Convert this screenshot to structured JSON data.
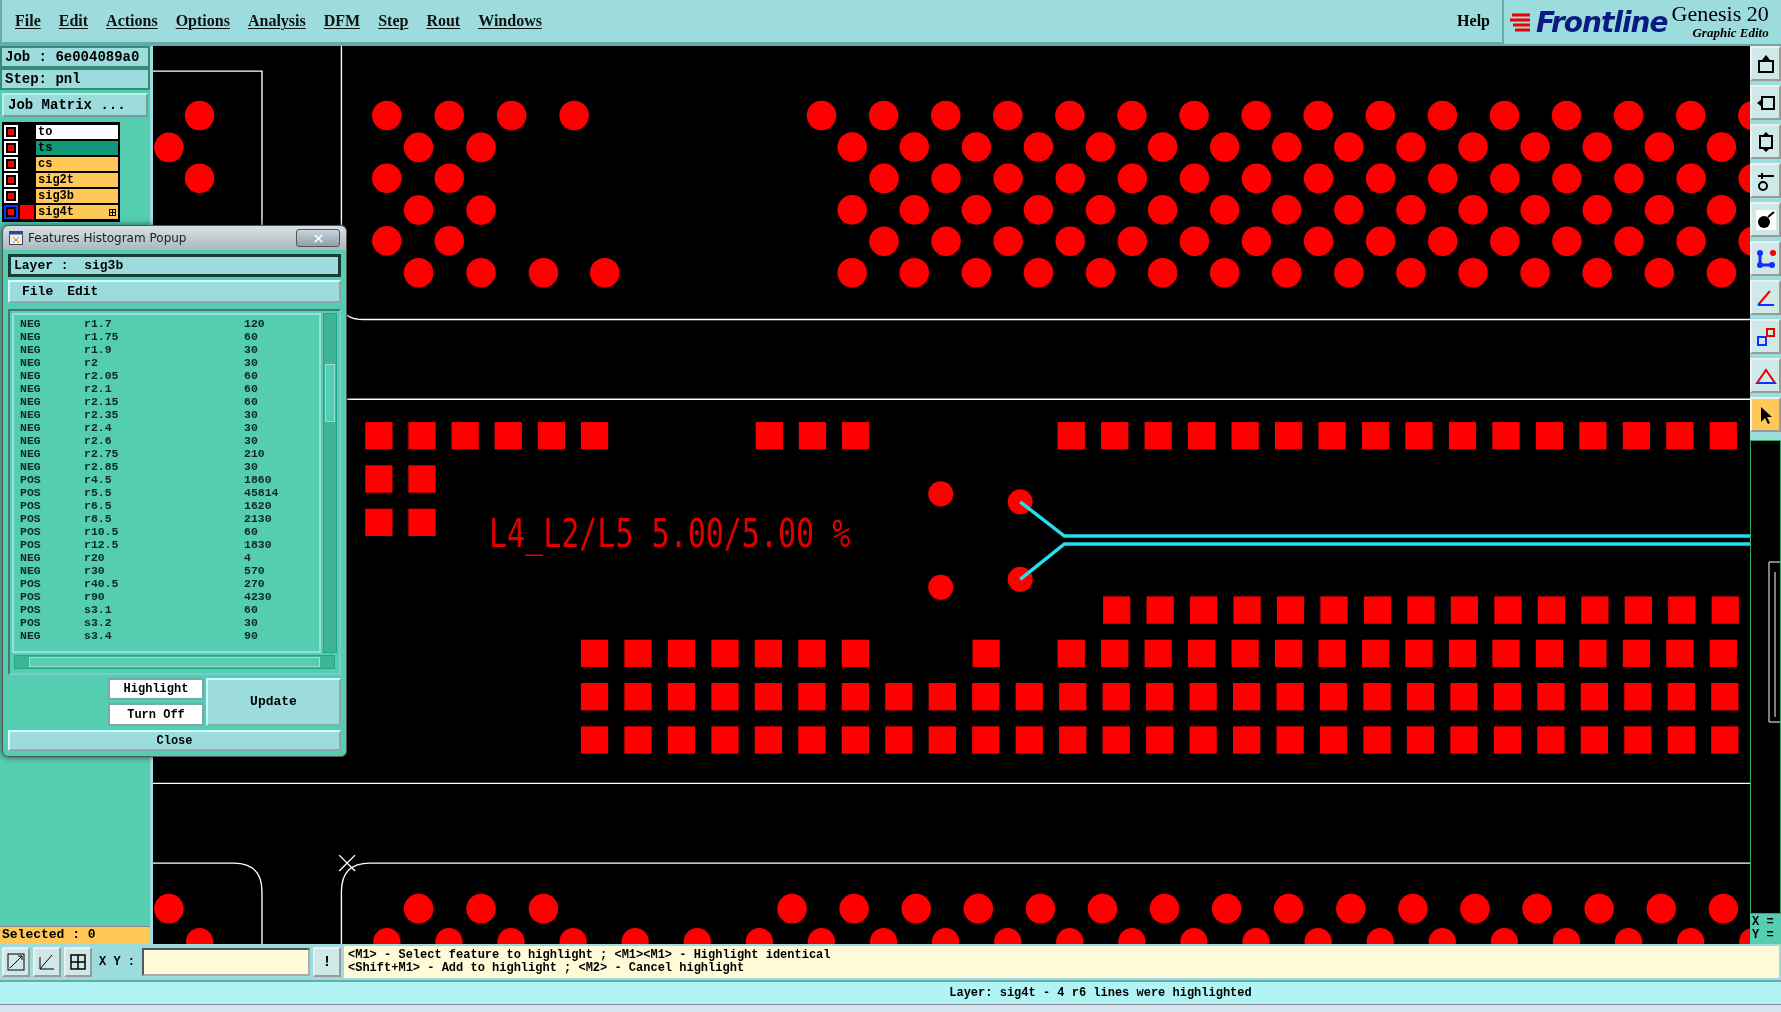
{
  "menu": [
    {
      "label": "File"
    },
    {
      "label": "Edit"
    },
    {
      "label": "Actions"
    },
    {
      "label": "Options"
    },
    {
      "label": "Analysis"
    },
    {
      "label": "DFM"
    },
    {
      "label": "Step"
    },
    {
      "label": "Rout"
    },
    {
      "label": "Windows"
    }
  ],
  "help": "Help",
  "logo": {
    "brand": "Frontline",
    "product": "Genesis 20",
    "subtitle": "Graphic Edito"
  },
  "job": "Job : 6e004089a0",
  "step": "Step: pnl",
  "job_matrix_button": "Job Matrix ...",
  "layers": [
    {
      "name": "to",
      "color": "#ffffff",
      "displayed": true,
      "selected": false
    },
    {
      "name": "ts",
      "color": "#119977",
      "displayed": true,
      "selected": false
    },
    {
      "name": "cs",
      "color": "#ffc857",
      "displayed": true,
      "selected": false
    },
    {
      "name": "sig2t",
      "color": "#ffc857",
      "displayed": true,
      "selected": false
    },
    {
      "name": "sig3b",
      "color": "#ffc857",
      "displayed": true,
      "selected": false
    },
    {
      "name": "sig4t",
      "color": "#ffc857",
      "displayed": true,
      "selected": true
    }
  ],
  "selected_count": "Selected : 0",
  "canvas": {
    "annotation": "L4_L2/L5 5.00/5.00 %"
  },
  "popup": {
    "title": "Features Histogram Popup",
    "layer": "Layer :  sig3b",
    "menu": [
      "File",
      "Edit"
    ],
    "rows": [
      {
        "polarity": "NEG",
        "symbol": "r1.7",
        "count": "120"
      },
      {
        "polarity": "NEG",
        "symbol": "r1.75",
        "count": "60"
      },
      {
        "polarity": "NEG",
        "symbol": "r1.9",
        "count": "30"
      },
      {
        "polarity": "NEG",
        "symbol": "r2",
        "count": "30"
      },
      {
        "polarity": "NEG",
        "symbol": "r2.05",
        "count": "60"
      },
      {
        "polarity": "NEG",
        "symbol": "r2.1",
        "count": "60"
      },
      {
        "polarity": "NEG",
        "symbol": "r2.15",
        "count": "60"
      },
      {
        "polarity": "NEG",
        "symbol": "r2.35",
        "count": "30"
      },
      {
        "polarity": "NEG",
        "symbol": "r2.4",
        "count": "30"
      },
      {
        "polarity": "NEG",
        "symbol": "r2.6",
        "count": "30"
      },
      {
        "polarity": "NEG",
        "symbol": "r2.75",
        "count": "210"
      },
      {
        "polarity": "NEG",
        "symbol": "r2.85",
        "count": "30"
      },
      {
        "polarity": "POS",
        "symbol": "r4.5",
        "count": "1860"
      },
      {
        "polarity": "POS",
        "symbol": "r5.5",
        "count": "45814"
      },
      {
        "polarity": "POS",
        "symbol": "r6.5",
        "count": "1620"
      },
      {
        "polarity": "POS",
        "symbol": "r8.5",
        "count": "2130"
      },
      {
        "polarity": "POS",
        "symbol": "r10.5",
        "count": "60"
      },
      {
        "polarity": "POS",
        "symbol": "r12.5",
        "count": "1830"
      },
      {
        "polarity": "NEG",
        "symbol": "r20",
        "count": "4"
      },
      {
        "polarity": "NEG",
        "symbol": "r30",
        "count": "570"
      },
      {
        "polarity": "POS",
        "symbol": "r40.5",
        "count": "270"
      },
      {
        "polarity": "POS",
        "symbol": "r90",
        "count": "4230"
      },
      {
        "polarity": "POS",
        "symbol": "s3.1",
        "count": "60"
      },
      {
        "polarity": "POS",
        "symbol": "s3.2",
        "count": "30"
      },
      {
        "polarity": "NEG",
        "symbol": "s3.4",
        "count": "90"
      }
    ],
    "highlight": "Highlight",
    "turn_off": "Turn Off",
    "update": "Update",
    "close": "Close"
  },
  "tools": [
    {
      "kind": "export",
      "selected": false
    },
    {
      "kind": "import",
      "selected": false
    },
    {
      "kind": "fit",
      "selected": false
    },
    {
      "kind": "brush",
      "selected": false
    },
    {
      "kind": "snap",
      "selected": false
    },
    {
      "kind": "graph",
      "selected": false
    },
    {
      "kind": "line",
      "selected": false
    },
    {
      "kind": "box",
      "selected": false
    },
    {
      "kind": "measure",
      "selected": false
    },
    {
      "kind": "pointer",
      "selected": true
    }
  ],
  "xy_readout": [
    "X =",
    "Y ="
  ],
  "coords_label": "X Y :",
  "alert": "!",
  "hints": [
    "<M1> - Select feature to highlight ; <M1><M1> - Highlight identical",
    "<Shift+M1> - Add to highlight ; <M2> - Cancel highlight"
  ],
  "status": "Layer: sig4t - 4 r6 lines were highlighted"
}
